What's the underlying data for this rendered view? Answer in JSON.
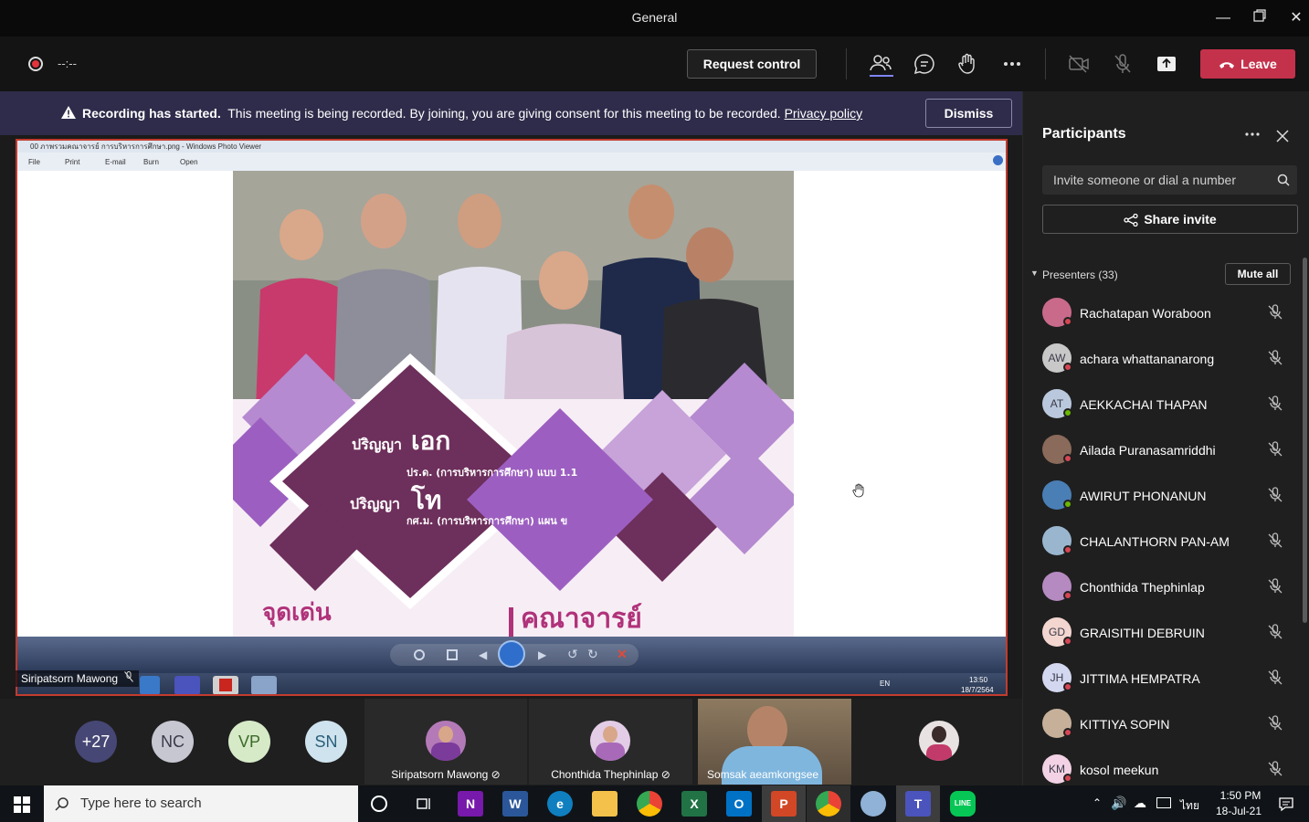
{
  "window": {
    "title": "General"
  },
  "toolbar": {
    "timer": "--:--",
    "request_control": "Request control",
    "leave": "Leave"
  },
  "banner": {
    "bold": "Recording has started.",
    "message": "This meeting is being recorded. By joining, you are giving consent for this meeting to be recorded.",
    "link": "Privacy policy",
    "dismiss": "Dismiss"
  },
  "shared": {
    "window_title": "00 ภาพรวมคณาจารย์ การบริหารการศึกษา.png - Windows Photo Viewer",
    "menu": [
      "File",
      "Print",
      "E-mail",
      "Burn",
      "Open"
    ],
    "presenter_name": "Siripatsorn Mawong",
    "poster": {
      "phd_prefix": "ปริญญา",
      "phd_big": "เอก",
      "phd_program": "ปร.ด. (การบริหารการศึกษา) แบบ 1.1",
      "ma_prefix": "ปริญญา",
      "ma_big": "โท",
      "ma_program": "กศ.ม. (การบริหารการศึกษา) แผน ข",
      "highlight": "จุดเด่น",
      "faculty": "คณาจารย์"
    },
    "inner_tray": {
      "lang": "EN",
      "time": "13:50",
      "date": "18/7/2564"
    }
  },
  "gallery": {
    "overflow": "+27",
    "initials": [
      "NC",
      "VP",
      "SN"
    ],
    "tiles": [
      "Siripatsorn Mawong",
      "Chonthida Thephinlap",
      "Somsak aeamkongsee"
    ]
  },
  "panel": {
    "title": "Participants",
    "invite_placeholder": "Invite someone or dial a number",
    "share_invite": "Share invite",
    "presenters_label": "Presenters (33)",
    "mute_all": "Mute all",
    "participants": [
      {
        "name": "Rachatapan Woraboon",
        "initials": "",
        "status": "busy",
        "color": "#c96a8a"
      },
      {
        "name": "achara whattananarong",
        "initials": "AW",
        "status": "busy",
        "color": "#c8c8c8"
      },
      {
        "name": "AEKKACHAI THAPAN",
        "initials": "AT",
        "status": "available",
        "color": "#b9c8dc"
      },
      {
        "name": "Ailada Puranasamriddhi",
        "initials": "",
        "status": "busy",
        "color": "#8a6a5a"
      },
      {
        "name": "AWIRUT PHONANUN",
        "initials": "",
        "status": "available",
        "color": "#4a7fb5"
      },
      {
        "name": "CHALANTHORN PAN-AM",
        "initials": "",
        "status": "busy",
        "color": "#9ab6cf"
      },
      {
        "name": "Chonthida Thephinlap",
        "initials": "",
        "status": "busy",
        "color": "#b58ac0"
      },
      {
        "name": "GRAISITHI DEBRUIN",
        "initials": "GD",
        "status": "busy",
        "color": "#f3d6cf"
      },
      {
        "name": "JITTIMA HEMPATRA",
        "initials": "JH",
        "status": "busy",
        "color": "#d3d8f0"
      },
      {
        "name": "KITTIYA SOPIN",
        "initials": "",
        "status": "busy",
        "color": "#c7b09a"
      },
      {
        "name": "kosol meekun",
        "initials": "KM",
        "status": "busy",
        "color": "#f2d2e4"
      }
    ]
  },
  "taskbar": {
    "search_placeholder": "Type here to search",
    "lang": "ไทย",
    "time": "1:50 PM",
    "date": "18-Jul-21"
  },
  "colors": {
    "accent": "#6264a7",
    "leave": "#c4314b",
    "busy": "#d74654",
    "available": "#6bb700"
  }
}
